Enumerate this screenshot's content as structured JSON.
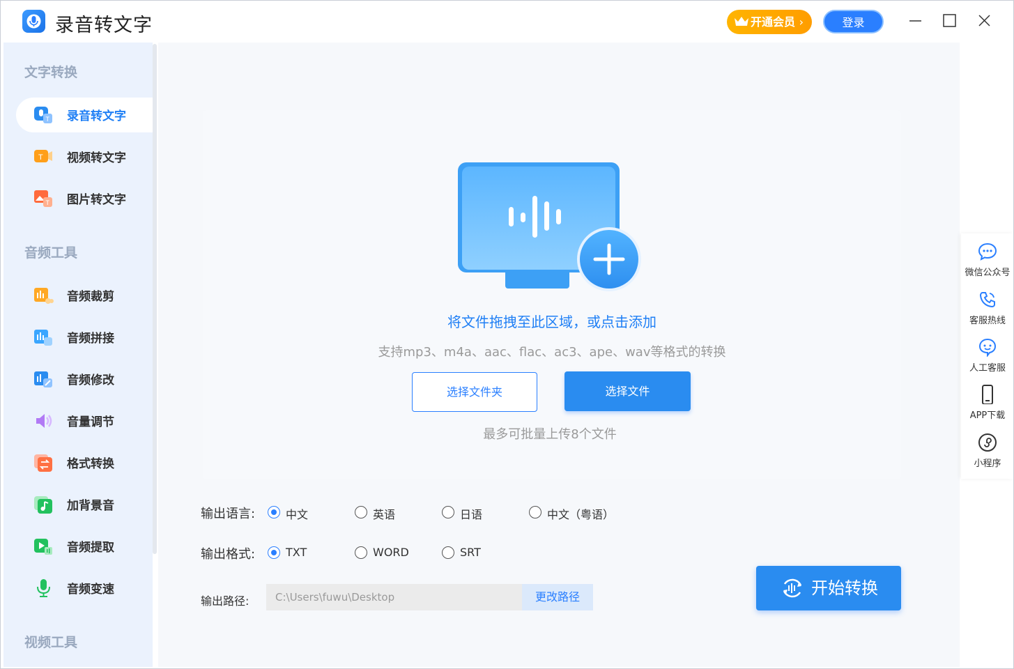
{
  "app": {
    "title": "录音转文字",
    "vip_label": "开通会员",
    "login_label": "登录"
  },
  "sidebar": {
    "sections": [
      {
        "title": "文字转换",
        "items": [
          {
            "label": "录音转文字",
            "icon": "mic-text-icon",
            "active": true
          },
          {
            "label": "视频转文字",
            "icon": "video-text-icon"
          },
          {
            "label": "图片转文字",
            "icon": "image-text-icon"
          }
        ]
      },
      {
        "title": "音频工具",
        "items": [
          {
            "label": "音频裁剪",
            "icon": "audio-cut-icon"
          },
          {
            "label": "音频拼接",
            "icon": "audio-join-icon"
          },
          {
            "label": "音频修改",
            "icon": "audio-edit-icon"
          },
          {
            "label": "音量调节",
            "icon": "volume-icon"
          },
          {
            "label": "格式转换",
            "icon": "format-convert-icon"
          },
          {
            "label": "加背景音",
            "icon": "music-note-icon"
          },
          {
            "label": "音频提取",
            "icon": "audio-extract-icon"
          },
          {
            "label": "音频变速",
            "icon": "audio-speed-icon"
          }
        ]
      },
      {
        "title": "视频工具",
        "items": []
      }
    ]
  },
  "dropzone": {
    "title": "将文件拖拽至此区域，或点击添加",
    "formats": "支持mp3、m4a、aac、flac、ac3、ape、wav等格式的转换",
    "select_folder_label": "选择文件夹",
    "select_file_label": "选择文件",
    "batch_note": "最多可批量上传8个文件"
  },
  "options": {
    "language": {
      "label": "输出语言:",
      "choices": [
        "中文",
        "英语",
        "日语",
        "中文（粤语）"
      ],
      "selected": "中文"
    },
    "format": {
      "label": "输出格式:",
      "choices": [
        "TXT",
        "WORD",
        "SRT"
      ],
      "selected": "TXT"
    },
    "path": {
      "label": "输出路径:",
      "value": "C:\\Users\\fuwu\\Desktop",
      "change_label": "更改路径"
    }
  },
  "start_label": "开始转换",
  "right_panel": [
    {
      "label": "微信公众号",
      "icon": "wechat-chat-icon"
    },
    {
      "label": "客服热线",
      "icon": "phone-icon"
    },
    {
      "label": "人工客服",
      "icon": "smile-chat-icon"
    },
    {
      "label": "APP下载",
      "icon": "mobile-icon"
    },
    {
      "label": "小程序",
      "icon": "mini-program-icon"
    }
  ],
  "colors": {
    "accent": "#2a7fff",
    "vip": "#ffa800",
    "sidebar_bg": "#ebf2fd"
  }
}
